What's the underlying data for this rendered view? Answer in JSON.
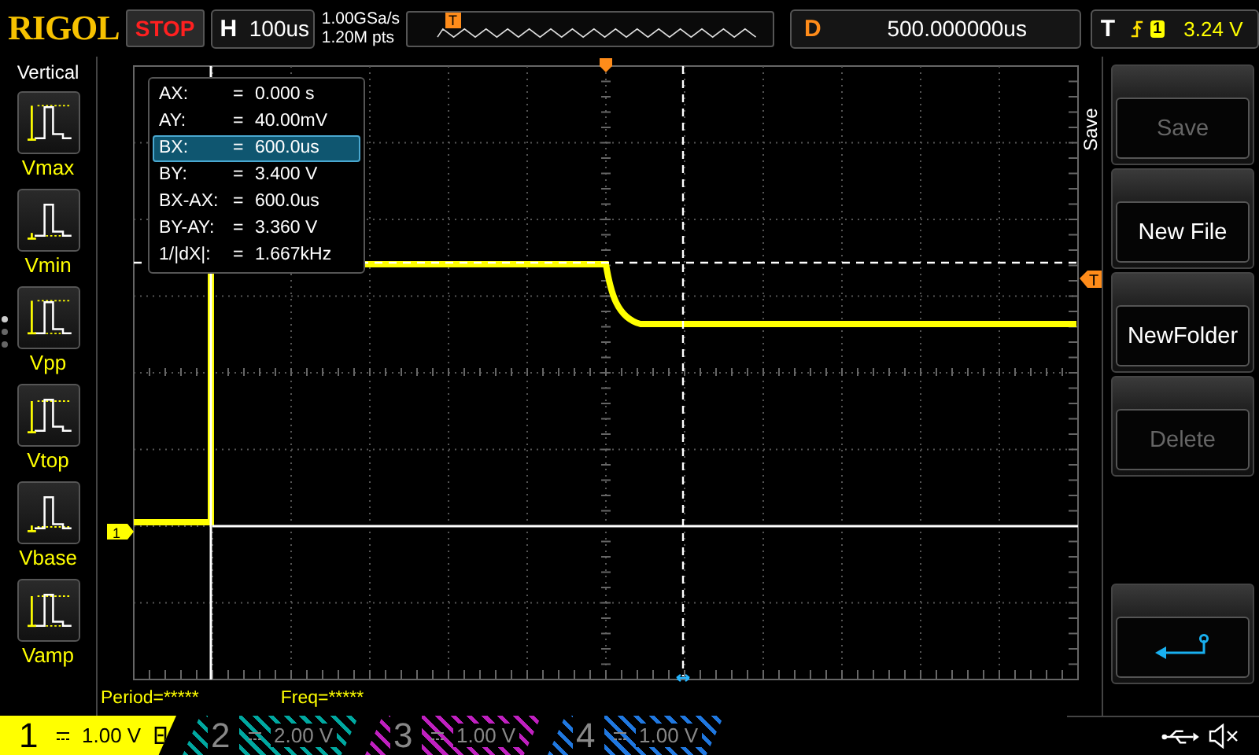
{
  "header": {
    "brand": "RIGOL",
    "run_state": "STOP",
    "timebase_label": "H",
    "timebase": "100us",
    "sample_rate": "1.00GSa/s",
    "memory_depth": "1.20M pts",
    "preview_marker": "T",
    "delay_label": "D",
    "delay": "500.000000us",
    "trigger_label": "T",
    "trigger_source": "1",
    "trigger_level": "3.24 V"
  },
  "left_menu": {
    "title": "Vertical",
    "items": [
      {
        "label": "Vmax",
        "kind": "vmax"
      },
      {
        "label": "Vmin",
        "kind": "vmin"
      },
      {
        "label": "Vpp",
        "kind": "vpp"
      },
      {
        "label": "Vtop",
        "kind": "vtop"
      },
      {
        "label": "Vbase",
        "kind": "vbase"
      },
      {
        "label": "Vamp",
        "kind": "vamp"
      }
    ]
  },
  "cursor_readout": [
    {
      "label": "AX:",
      "equals": "=",
      "value": "0.000 s",
      "selected": false
    },
    {
      "label": "AY:",
      "equals": "=",
      "value": "40.00mV",
      "selected": false
    },
    {
      "label": "BX:",
      "equals": "=",
      "value": "600.0us",
      "selected": true
    },
    {
      "label": "BY:",
      "equals": "=",
      "value": "3.400 V",
      "selected": false
    },
    {
      "label": "BX-AX:",
      "equals": "=",
      "value": "600.0us",
      "selected": false
    },
    {
      "label": "BY-AY:",
      "equals": "=",
      "value": "3.360 V",
      "selected": false
    },
    {
      "label": "1/|dX|:",
      "equals": "=",
      "value": "1.667kHz",
      "selected": false
    }
  ],
  "plot": {
    "channel_marker": "1",
    "trigger_marker": "T"
  },
  "measurements": [
    "Period=*****",
    "Freq=*****"
  ],
  "right_menu": {
    "title": "Save",
    "buttons": [
      {
        "kind": "text",
        "label": "Save",
        "disabled": true
      },
      {
        "kind": "text",
        "label": "New File",
        "disabled": false
      },
      {
        "kind": "text",
        "label": "NewFolder",
        "disabled": false
      },
      {
        "kind": "text",
        "label": "Delete",
        "disabled": true
      },
      {
        "kind": "spacer"
      },
      {
        "kind": "back"
      }
    ]
  },
  "channels": [
    {
      "number": "1",
      "scale": "1.00 V",
      "on": true,
      "color": "#ffff00"
    },
    {
      "number": "2",
      "scale": "2.00 V",
      "on": false,
      "color": "#00a8a0"
    },
    {
      "number": "3",
      "scale": "1.00 V",
      "on": false,
      "color": "#c020c0"
    },
    {
      "number": "4",
      "scale": "1.00 V",
      "on": false,
      "color": "#2078e0"
    }
  ]
}
